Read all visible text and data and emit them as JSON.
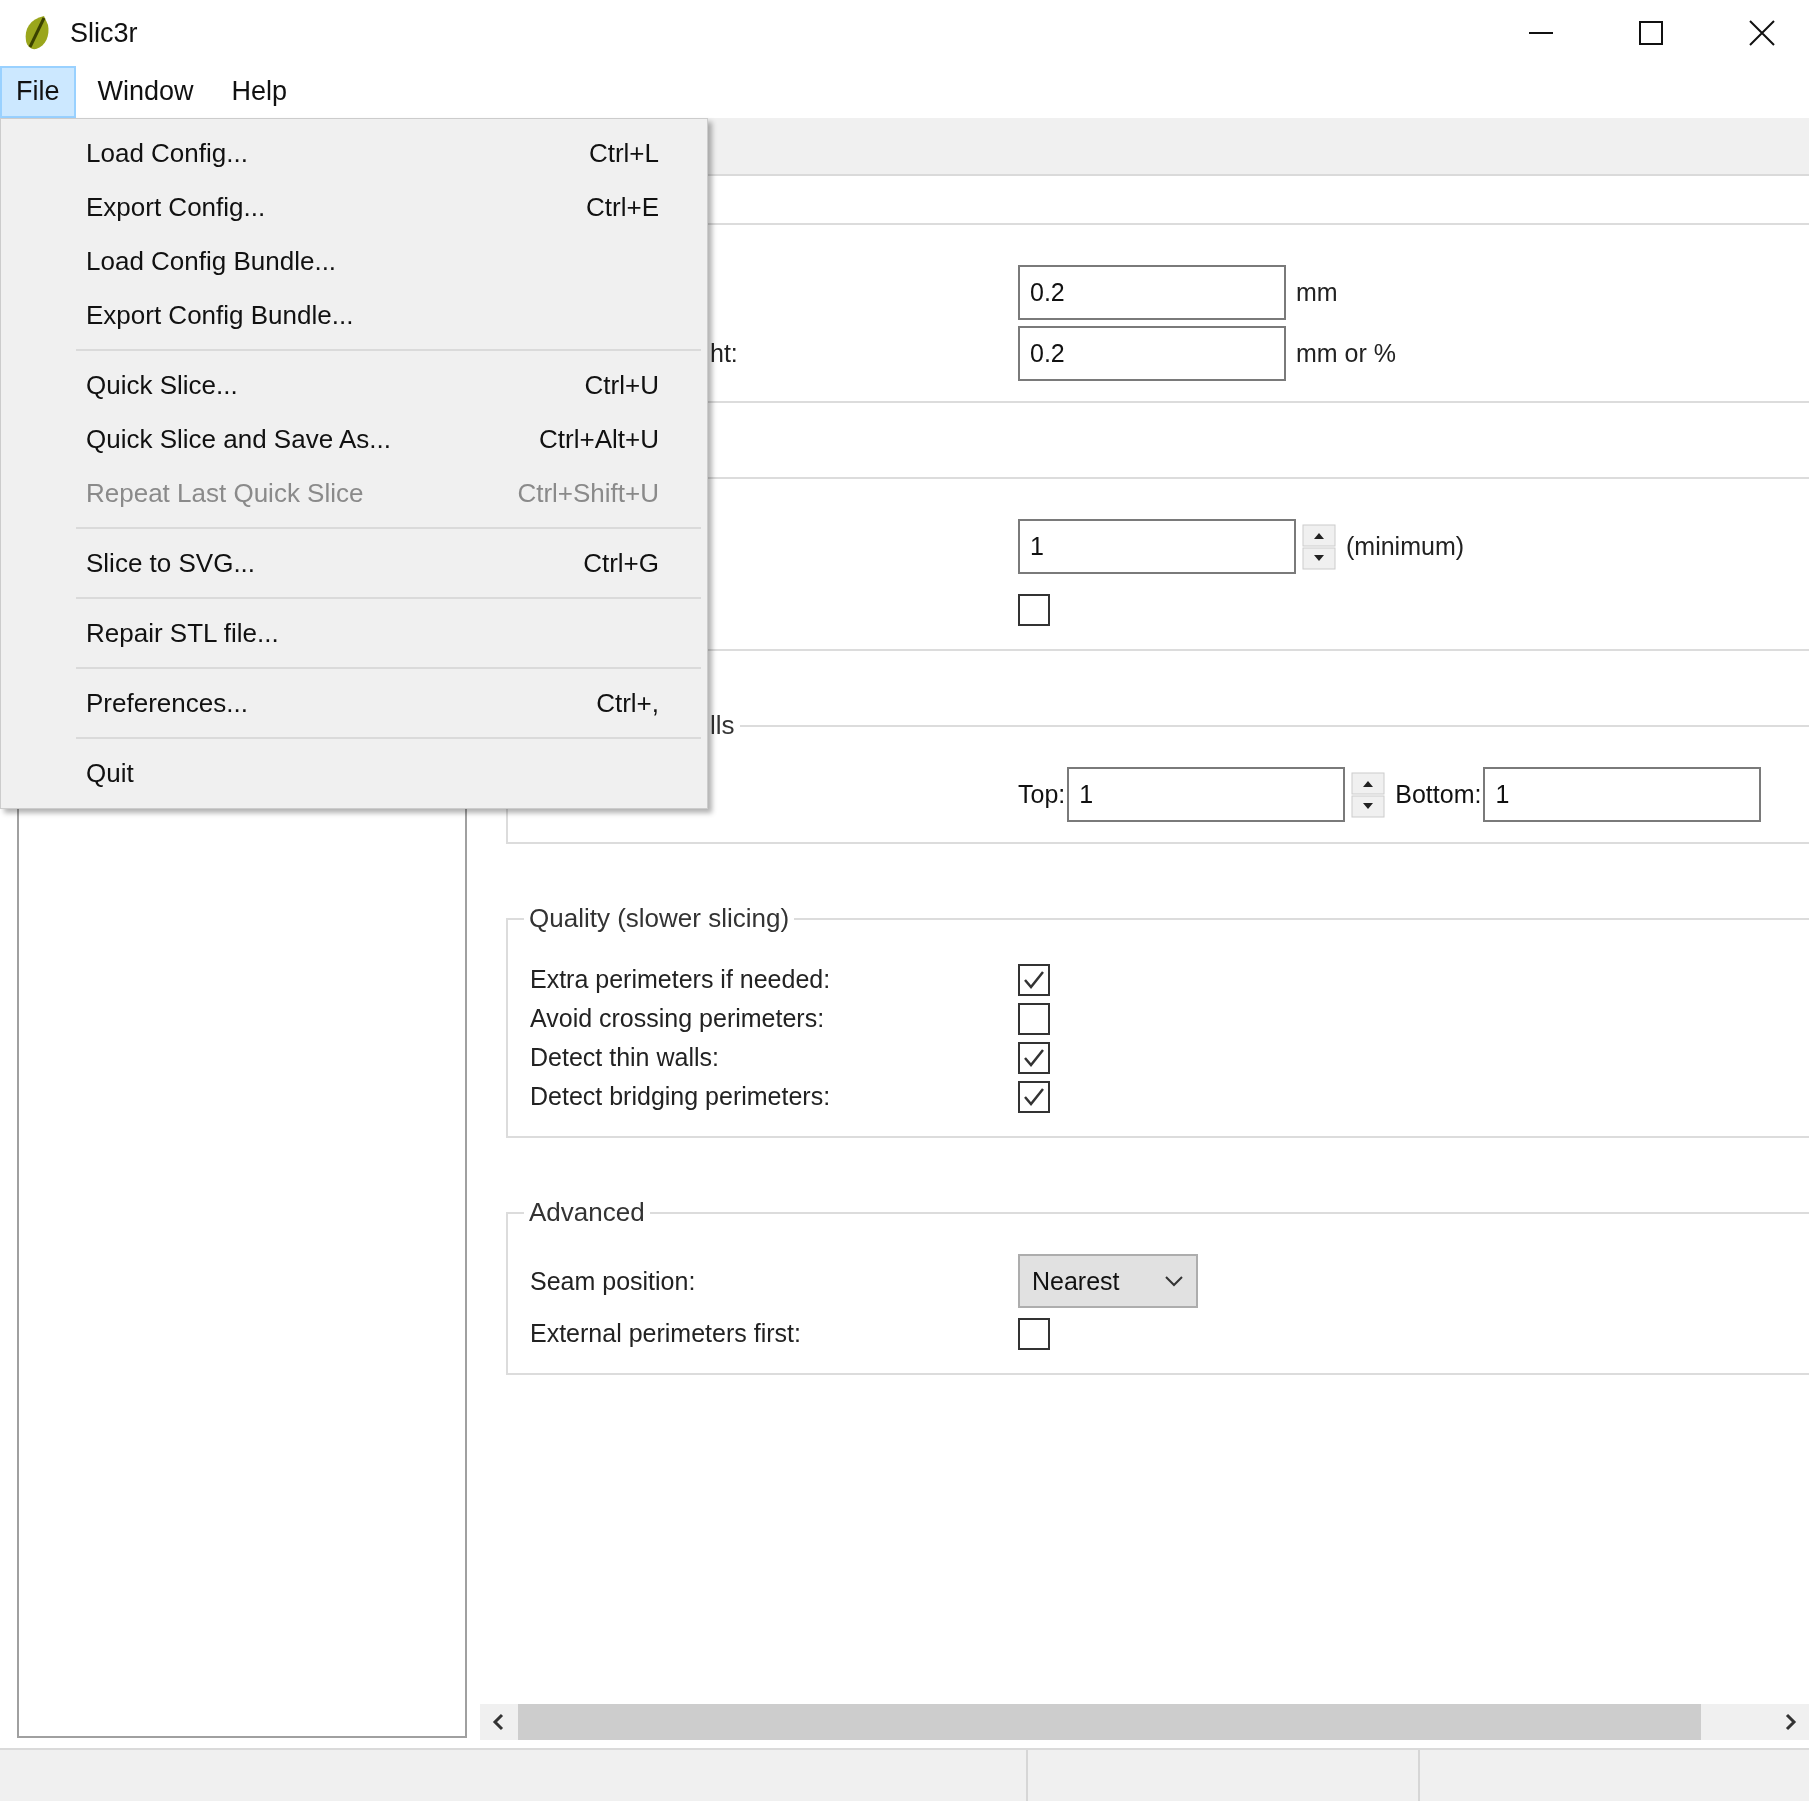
{
  "window": {
    "title": "Slic3r"
  },
  "menubar": [
    {
      "label": "File",
      "selected": true
    },
    {
      "label": "Window",
      "selected": false
    },
    {
      "label": "Help",
      "selected": false
    }
  ],
  "menu": [
    {
      "kind": "item",
      "label": "Load Config...",
      "shortcut": "Ctrl+L",
      "disabled": false
    },
    {
      "kind": "item",
      "label": "Export Config...",
      "shortcut": "Ctrl+E",
      "disabled": false
    },
    {
      "kind": "item",
      "label": "Load Config Bundle...",
      "disabled": false
    },
    {
      "kind": "item",
      "label": "Export Config Bundle...",
      "disabled": false
    },
    {
      "kind": "separator"
    },
    {
      "kind": "item",
      "label": "Quick Slice...",
      "shortcut": "Ctrl+U",
      "disabled": false
    },
    {
      "kind": "item",
      "label": "Quick Slice and Save As...",
      "shortcut": "Ctrl+Alt+U",
      "disabled": false
    },
    {
      "kind": "item",
      "label": "Repeat Last Quick Slice",
      "shortcut": "Ctrl+Shift+U",
      "disabled": true
    },
    {
      "kind": "separator"
    },
    {
      "kind": "item",
      "label": "Slice to SVG...",
      "shortcut": "Ctrl+G",
      "disabled": false
    },
    {
      "kind": "separator"
    },
    {
      "kind": "item",
      "label": "Repair STL file...",
      "disabled": false
    },
    {
      "kind": "separator"
    },
    {
      "kind": "item",
      "label": "Preferences...",
      "shortcut": "Ctrl+,",
      "disabled": false
    },
    {
      "kind": "separator"
    },
    {
      "kind": "item",
      "label": "Quit",
      "disabled": false
    }
  ],
  "groups": [
    {
      "rows": [
        {
          "kind": "text",
          "value": "0.2",
          "unit": "mm"
        },
        {
          "kind": "text",
          "label": "ht:",
          "covered": true,
          "value": "0.2",
          "unit": "mm or %"
        }
      ]
    },
    {
      "rows": [
        {
          "kind": "spinner",
          "value": "1",
          "unit": "(minimum)"
        },
        {
          "kind": "checkbox",
          "checked": false
        }
      ]
    },
    {
      "legend": "lls",
      "covered": true,
      "rows": [
        {
          "kind": "pair",
          "label": "Top:",
          "value": "1",
          "label2": "Bottom:",
          "value2": "1"
        }
      ]
    },
    {
      "legend": "Quality (slower slicing)",
      "covered": false,
      "rows": [
        {
          "kind": "checkbox",
          "label": "Extra perimeters if needed:",
          "checked": true
        },
        {
          "kind": "checkbox",
          "label": "Avoid crossing perimeters:",
          "checked": false
        },
        {
          "kind": "checkbox",
          "label": "Detect thin walls:",
          "checked": true
        },
        {
          "kind": "checkbox",
          "label": "Detect bridging perimeters:",
          "checked": true
        }
      ]
    },
    {
      "legend": "Advanced",
      "covered": false,
      "rows": [
        {
          "kind": "select",
          "label": "Seam position:",
          "value": "Nearest"
        },
        {
          "kind": "checkbox",
          "label": "External perimeters first:",
          "checked": false
        }
      ]
    }
  ]
}
